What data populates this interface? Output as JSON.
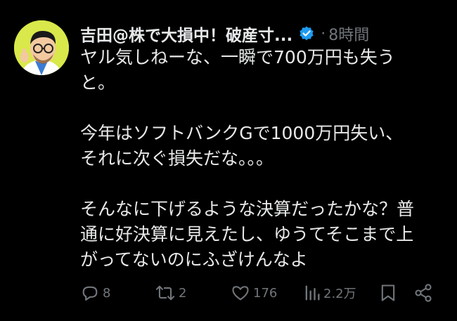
{
  "user": {
    "display_name": "吉田@株で大損中！破産寸...",
    "verified": true,
    "separator": "·",
    "timestamp": "8時間",
    "avatar_icon": "cartoon-man-avatar"
  },
  "tweet": {
    "paragraphs": [
      "ヤル気しねーな、一瞬で700万円も失う\nと。",
      "今年はソフトバンクGで1000万円失い、\nそれに次ぐ損失だな。。。",
      "そんなに下げるような決算だったかな？普\n通に好決算に見えたし、ゆうてそこまで上\nがってないのにふざけんなよ"
    ]
  },
  "actions": {
    "reply_count": "8",
    "retweet_count": "2",
    "like_count": "176",
    "view_count": "2.2万"
  },
  "colors": {
    "background": "#000000",
    "text": "#e7e9ea",
    "muted": "#71767b",
    "verified_badge": "#1d9bf0",
    "avatar_bg": "#d9e84a"
  }
}
